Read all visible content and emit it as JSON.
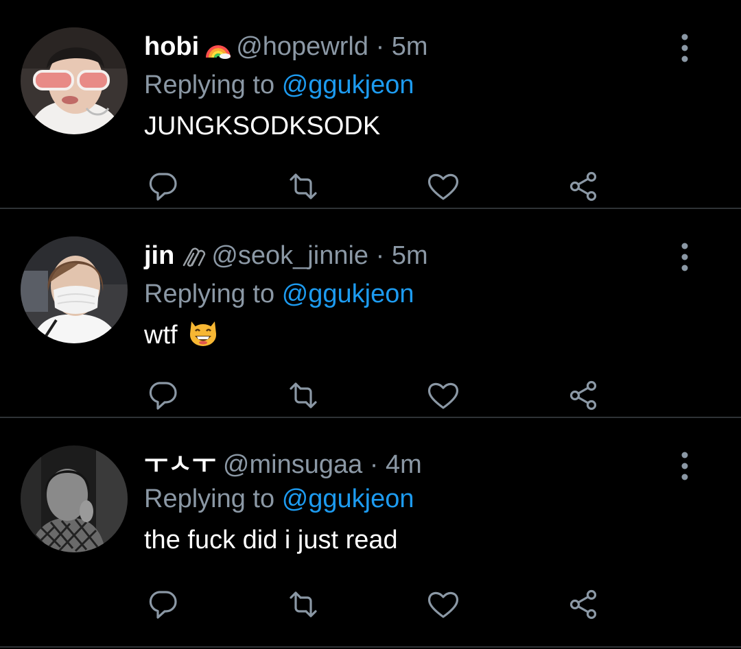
{
  "colors": {
    "background": "#000000",
    "text_primary": "#ffffff",
    "text_secondary": "#8b98a5",
    "link": "#1d9bf0",
    "divider": "#2f3336"
  },
  "tweets": [
    {
      "display_name": "hobi",
      "name_emoji": "rainbow-icon",
      "handle": "@hopewrld",
      "separator": "·",
      "time": "5m",
      "replying_prefix": "Replying to",
      "replying_to": "@ggukjeon",
      "text": "JUNGKSODKSODK"
    },
    {
      "display_name": "jin",
      "name_emoji": "paperclips-icon",
      "handle": "@seok_jinnie",
      "separator": "·",
      "time": "5m",
      "replying_prefix": "Replying to",
      "replying_to": "@ggukjeon",
      "text": "wtf",
      "text_emoji": "grinning-cat-icon"
    },
    {
      "display_name": "ㅜㅅㅜ",
      "handle": "@minsugaa",
      "separator": "·",
      "time": "4m",
      "replying_prefix": "Replying to",
      "replying_to": "@ggukjeon",
      "text": "the fuck did i just read"
    }
  ],
  "actions": [
    "reply-icon",
    "retweet-icon",
    "like-icon",
    "share-icon"
  ]
}
